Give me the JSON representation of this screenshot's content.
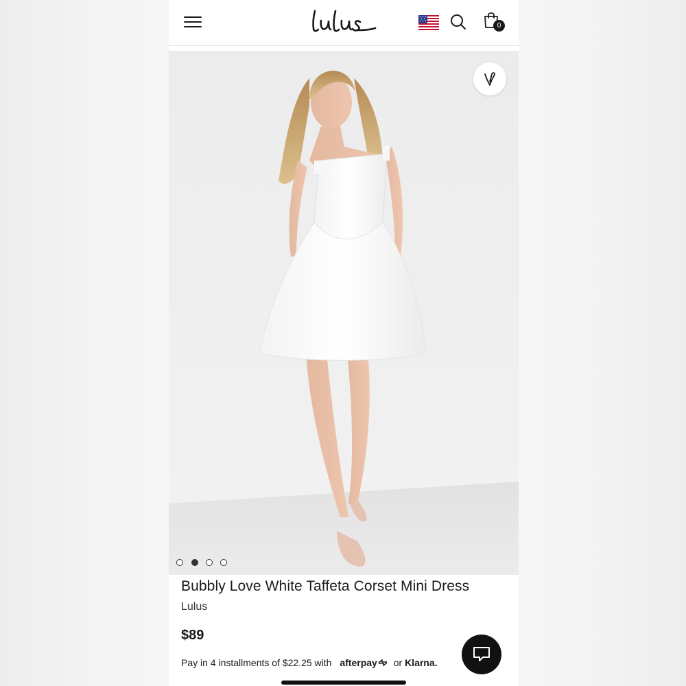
{
  "header": {
    "logo_text": "lulus",
    "menu_icon": "hamburger-menu-icon",
    "flag_icon": "us-flag-icon",
    "search_icon": "search-icon",
    "cart_icon": "shopping-bag-icon",
    "cart_count": "0"
  },
  "gallery": {
    "favorite_icon": "heart-outline-icon",
    "total_images": 4,
    "active_index": 1
  },
  "product": {
    "title": "Bubbly Love White Taffeta Corset Mini Dress",
    "brand": "Lulus",
    "price": "$89",
    "installments_text": "Pay in 4 installments of $22.25 with",
    "afterpay_label": "afterpay",
    "or_text": "or",
    "klarna_label": "Klarna."
  },
  "chat": {
    "icon": "chat-bubble-icon"
  },
  "colors": {
    "accent": "#111111",
    "background": "#ffffff",
    "image_bg": "#efefef"
  }
}
